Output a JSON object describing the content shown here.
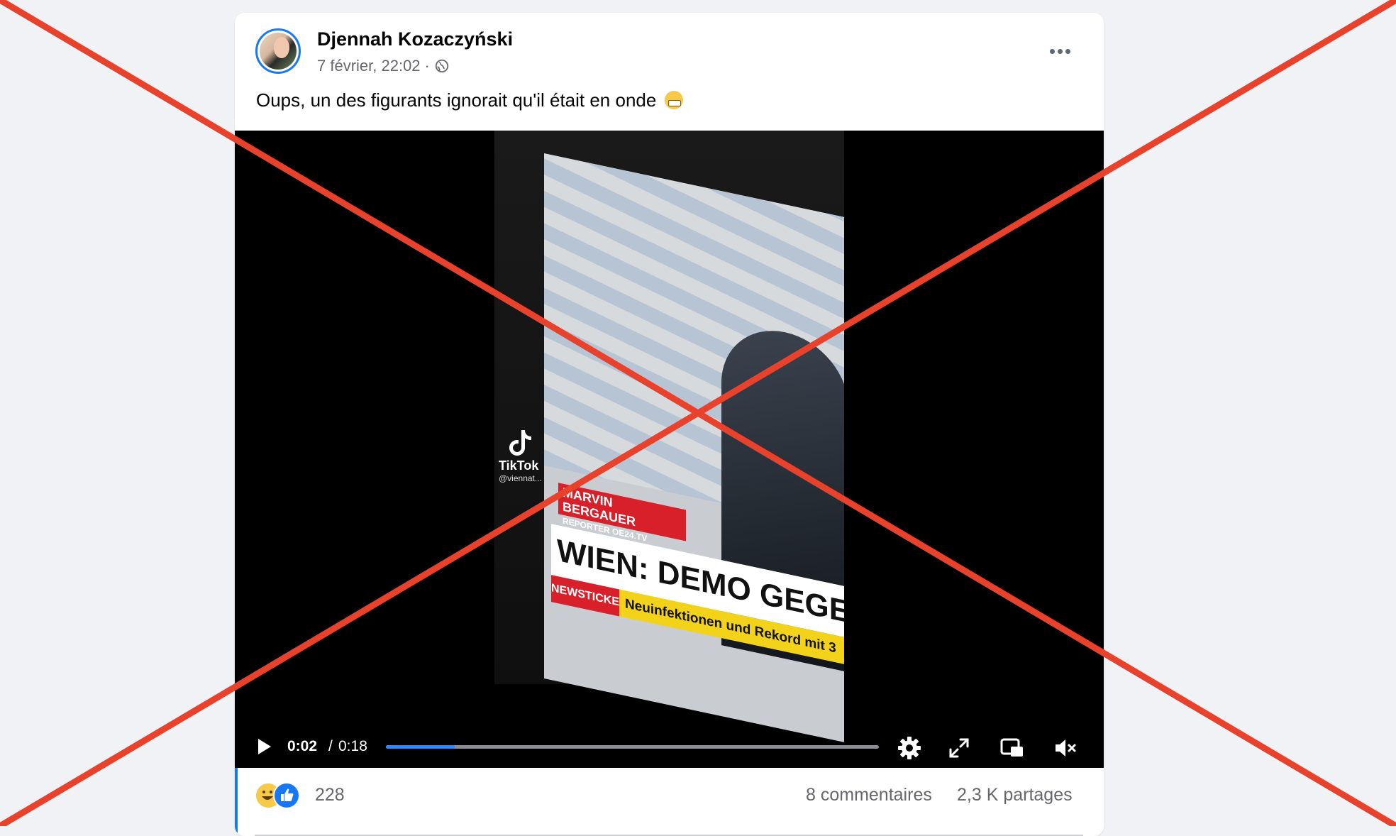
{
  "post": {
    "author": "Djennah Kozaczyński",
    "date": "7 février, 22:02",
    "separator": "·",
    "visibility_icon": "globe-icon",
    "text": "Oups, un des figurants ignorait qu'il était en onde",
    "emoji": "grimacing-face-icon"
  },
  "video": {
    "tv_reporter_name": "MARVIN BERGAUER",
    "tv_reporter_role": "REPORTER OE24.TV",
    "tv_headline": "WIEN: DEMO GEGEN KLIMA",
    "tv_ticker_label": "NEWSTICKER",
    "tv_ticker_text": "Neuinfektionen und Rekord mit 3",
    "tiktok_label": "TikTok",
    "tiktok_handle": "@viennat...",
    "time_current": "0:02",
    "time_separator": "/",
    "time_total": "0:18",
    "progress_fraction": 0.14,
    "progress_color": "#2d88ff"
  },
  "footer": {
    "reaction_count": "228",
    "comments": "8 commentaires",
    "shares": "2,3 K partages"
  },
  "colors": {
    "accent": "#1877f2",
    "cross_overlay": "#e8412c"
  }
}
